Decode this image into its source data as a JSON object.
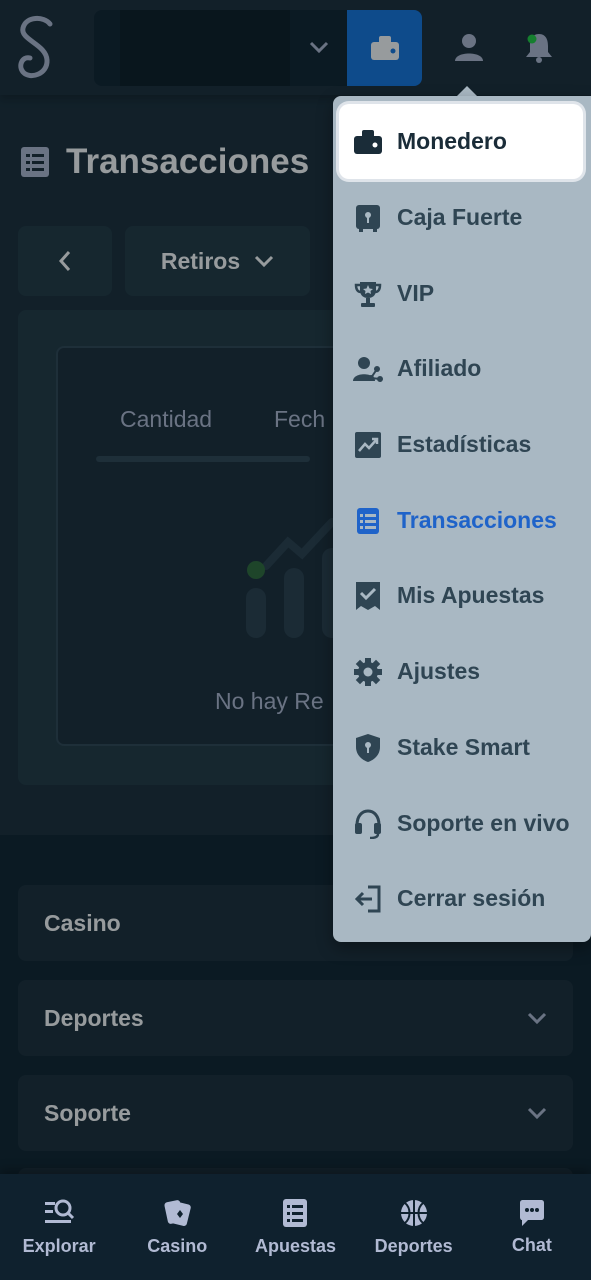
{
  "header": {
    "logo_icon": "stake-s-logo",
    "wallet_icon": "wallet-icon",
    "user_icon": "user-icon",
    "bell_icon": "bell-icon",
    "colors": {
      "accent": "#1475e1",
      "bg": "#1a2c38",
      "dark": "#0f212e",
      "online": "#1fff20"
    }
  },
  "page": {
    "title": "Transacciones",
    "filter_label": "Retiros",
    "columns": [
      "Cantidad",
      "Fech"
    ],
    "empty_text": "No hay Re"
  },
  "menu": {
    "items": [
      {
        "label": "Monedero",
        "icon": "wallet-icon"
      },
      {
        "label": "Caja Fuerte",
        "icon": "vault-icon"
      },
      {
        "label": "VIP",
        "icon": "trophy-icon"
      },
      {
        "label": "Afiliado",
        "icon": "affiliate-icon"
      },
      {
        "label": "Estadísticas",
        "icon": "stats-icon"
      },
      {
        "label": "Transacciones",
        "icon": "transactions-icon"
      },
      {
        "label": "Mis Apuestas",
        "icon": "bets-icon"
      },
      {
        "label": "Ajustes",
        "icon": "gear-icon"
      },
      {
        "label": "Stake Smart",
        "icon": "shield-icon"
      },
      {
        "label": "Soporte en vivo",
        "icon": "headset-icon"
      },
      {
        "label": "Cerrar sesión",
        "icon": "logout-icon"
      }
    ]
  },
  "footer": {
    "sections": [
      "Casino",
      "Deportes",
      "Soporte"
    ]
  },
  "bottom_nav": {
    "items": [
      {
        "label": "Explorar",
        "icon": "explore-icon"
      },
      {
        "label": "Casino",
        "icon": "cards-icon"
      },
      {
        "label": "Apuestas",
        "icon": "bets-list-icon"
      },
      {
        "label": "Deportes",
        "icon": "basketball-icon"
      },
      {
        "label": "Chat",
        "icon": "chat-icon"
      }
    ]
  }
}
